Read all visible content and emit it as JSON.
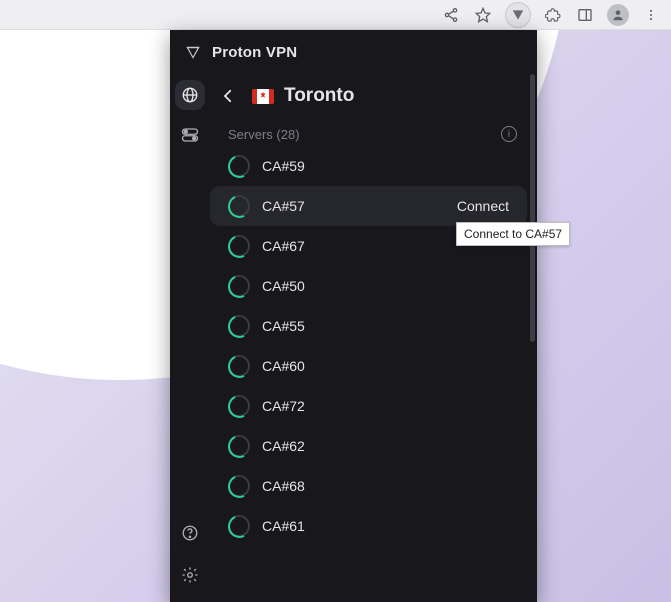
{
  "browser": {
    "icons": [
      "share",
      "star",
      "protonvpn",
      "extensions",
      "panel",
      "profile",
      "menu"
    ]
  },
  "popup": {
    "brand": "Proton VPN",
    "location_title": "Toronto",
    "servers_label": "Servers (28)",
    "connect_label": "Connect",
    "hovered_index": 1,
    "servers": [
      {
        "name": "CA#59"
      },
      {
        "name": "CA#57"
      },
      {
        "name": "CA#67"
      },
      {
        "name": "CA#50"
      },
      {
        "name": "CA#55"
      },
      {
        "name": "CA#60"
      },
      {
        "name": "CA#72"
      },
      {
        "name": "CA#62"
      },
      {
        "name": "CA#68"
      },
      {
        "name": "CA#61"
      }
    ]
  },
  "tooltip": "Connect to CA#57"
}
